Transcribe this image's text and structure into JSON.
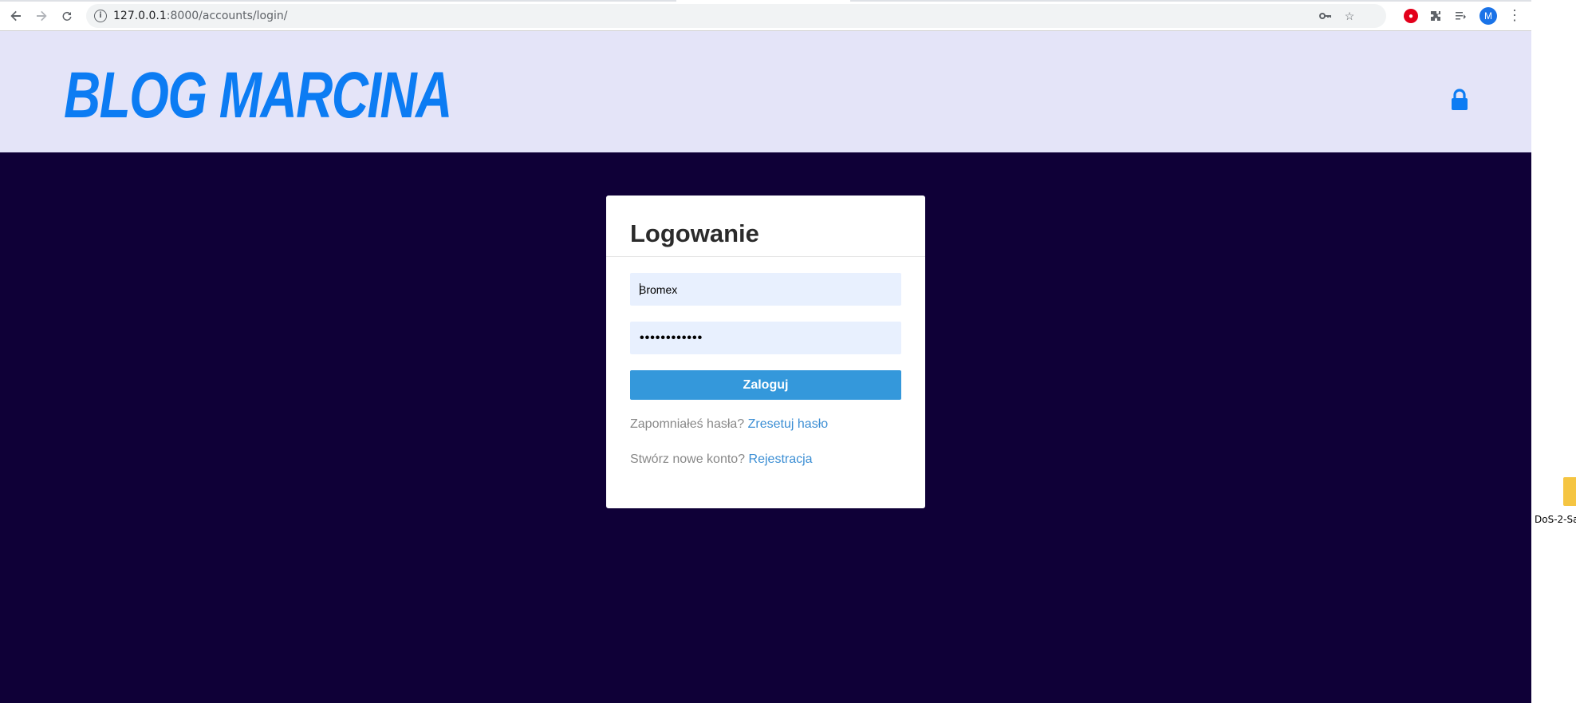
{
  "browser": {
    "url_host": "127.0.0.1",
    "url_path": ":8000/accounts/login/",
    "profile_initial": "M",
    "icons": [
      "back-arrow-icon",
      "forward-arrow-icon",
      "reload-icon",
      "info-icon",
      "key-icon",
      "star-icon",
      "extension-red-icon",
      "puzzle-icon",
      "reading-list-icon",
      "menu-dots-icon"
    ]
  },
  "header": {
    "brand": "Blog Marcina",
    "accent_color": "#0c7cf3",
    "background": "#e4e4f8"
  },
  "login": {
    "title": "Logowanie",
    "username_value": "Bromex",
    "password_value": "••••••••••••",
    "submit_label": "Zaloguj",
    "forgot_prefix": "Zapomniałeś hasła?",
    "forgot_link": "Zresetuj hasło",
    "register_prefix": "Stwórz nowe konto?",
    "register_link": "Rejestracja"
  },
  "page": {
    "background": "#0f0037",
    "button_color": "#3498db"
  },
  "desktop": {
    "icon_label": "DoS-2-Sa"
  }
}
